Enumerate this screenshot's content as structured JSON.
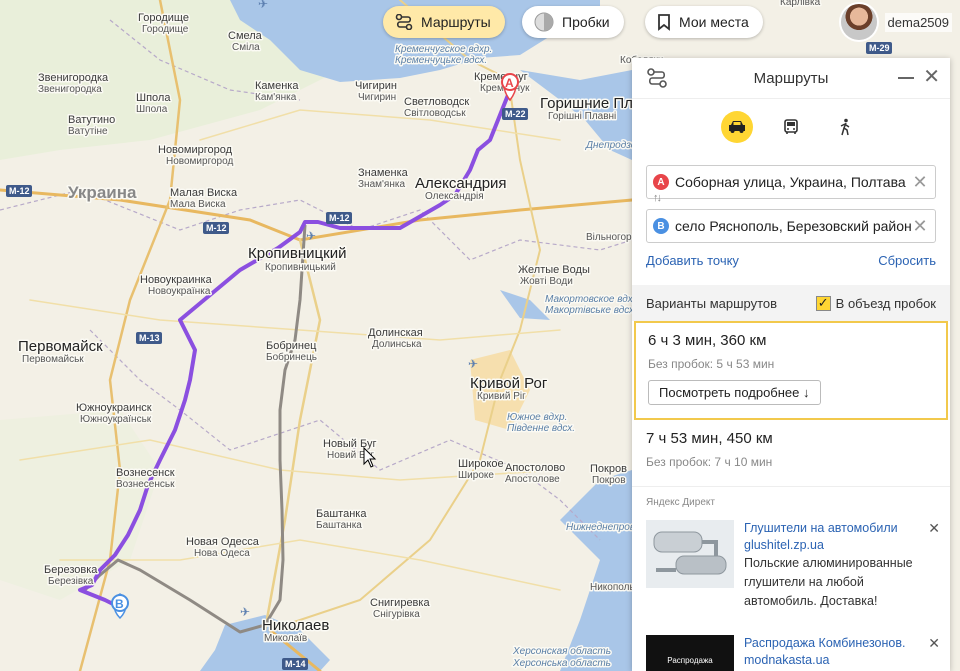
{
  "toolbar": {
    "routes_label": "Маршруты",
    "traffic_label": "Пробки",
    "my_places_label": "Мои места"
  },
  "user": {
    "name": "dema2509"
  },
  "map": {
    "country": "Украина",
    "cities": [
      {
        "name": "Городище",
        "sub": "Городище"
      },
      {
        "name": "Смела",
        "sub": "Сміла"
      },
      {
        "name": "Каменка",
        "sub": "Кам'янка"
      },
      {
        "name": "Звенигородка",
        "sub": "Звенигородка"
      },
      {
        "name": "Шпола",
        "sub": "Шпола"
      },
      {
        "name": "Ватутино",
        "sub": "Ватутіне"
      },
      {
        "name": "Новомиргород",
        "sub": "Новомиргород"
      },
      {
        "name": "Малая Виска",
        "sub": "Мала Виска"
      },
      {
        "name": "Чигирин",
        "sub": "Чигирин"
      },
      {
        "name": "Светловодск",
        "sub": "Світловодськ"
      },
      {
        "name": "Кременчуг",
        "sub": "Кременчук"
      },
      {
        "name": "Горишние Плавни",
        "sub": "Горішні Плавні"
      },
      {
        "name": "Знаменка",
        "sub": "Знам'янка"
      },
      {
        "name": "Александрия",
        "sub": "Олександрія"
      },
      {
        "name": "Кропивницкий",
        "sub": "Кропивницький"
      },
      {
        "name": "Новоукраинка",
        "sub": "Новоукраїнка"
      },
      {
        "name": "Желтые Воды",
        "sub": "Жовті Води"
      },
      {
        "name": "Первомайск",
        "sub": "Первомайськ"
      },
      {
        "name": "Долинская",
        "sub": "Долинська"
      },
      {
        "name": "Бобринец",
        "sub": "Бобринець"
      },
      {
        "name": "Кривой Рог",
        "sub": "Кривий Ріг"
      },
      {
        "name": "Южноукраинск",
        "sub": "Южноукраїнськ"
      },
      {
        "name": "Новый Буг",
        "sub": "Новий Буг"
      },
      {
        "name": "Вознесенск",
        "sub": "Вознесенськ"
      },
      {
        "name": "Широкое",
        "sub": "Широке"
      },
      {
        "name": "Апостолово",
        "sub": "Апостолове"
      },
      {
        "name": "Покров",
        "sub": "Покров"
      },
      {
        "name": "Новая Одесса",
        "sub": "Нова Одеса"
      },
      {
        "name": "Баштанка",
        "sub": "Баштанка"
      },
      {
        "name": "Березовка",
        "sub": "Березівка"
      },
      {
        "name": "Снигиревка",
        "sub": "Снігурівка"
      },
      {
        "name": "Николаев",
        "sub": "Миколаїв"
      },
      {
        "name": "Кобеляки",
        "sub": ""
      },
      {
        "name": "Карлівка",
        "sub": ""
      },
      {
        "name": "Вільногорськ",
        "sub": ""
      },
      {
        "name": "Никополь",
        "sub": ""
      }
    ],
    "water": [
      "Кременчугское вдхр.",
      "Кременчуцьке вдсх.",
      "Днепродзержинское вдхр.",
      "Макортовское вдхр.",
      "Макортівське вдсх.",
      "Южное вдхр.",
      "Південне вдсх.",
      "Херсонская область",
      "Херсонська область",
      "Нижнеднепровский нацпарк"
    ],
    "highways": [
      "M-12",
      "M-13",
      "M-14",
      "M-22",
      "M-29",
      "Н-12"
    ],
    "route_colors": {
      "primary": "#8b4fe0",
      "alternative": "#8f8a84"
    },
    "markers": {
      "start": "A",
      "end": "B"
    }
  },
  "panel": {
    "title": "Маршруты",
    "point_a_badge": "A",
    "point_a": "Соборная улица, Украина, Полтава",
    "point_b_badge": "B",
    "point_b": "село Ряснополь, Березовский район",
    "add_point": "Добавить точку",
    "reset": "Сбросить",
    "variants_label": "Варианты маршрутов",
    "avoid_traffic": "В объезд пробок",
    "routes": [
      {
        "time": "6 ч 3 мин, 360 км",
        "no_traffic": "Без пробок: 5 ч 53 мин",
        "details": "Посмотреть подробнее ↓"
      },
      {
        "time": "7 ч 53 мин, 450 км",
        "no_traffic": "Без пробок: 7 ч 10 мин"
      }
    ],
    "ads_label": "Яндекс Директ",
    "ads": [
      {
        "title": "Глушители на автомобили glushitel.zp.ua",
        "text": "Польские алюминированные глушители на любой автомобиль. Доставка!"
      },
      {
        "title": "Распродажа Комбинезонов. modnakasta.ua",
        "text": ""
      }
    ],
    "ad_image_text": "Распродажа"
  },
  "colors": {
    "accent": "#ffd633",
    "link": "#2b63b3",
    "marker_a": "#e8454a",
    "marker_b": "#4a90e2"
  }
}
